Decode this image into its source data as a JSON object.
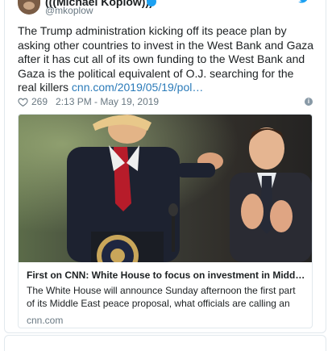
{
  "author": {
    "display_name": "(((Michael Koplow)))",
    "handle": "@mkoplow"
  },
  "tweet": {
    "text": "The Trump administration kicking off its peace plan by asking other countries to invest in the West Bank and Gaza after it has cut all of its own funding to the West Bank and Gaza is the political equivalent of O.J. searching for the real killers",
    "link": "cnn.com/2019/05/19/pol…"
  },
  "meta": {
    "likes": "269",
    "timestamp": "2:13 PM - May 19, 2019",
    "info_glyph": "i"
  },
  "link_card": {
    "title": "First on CNN: White House to focus on investment in Middle E…",
    "description": "The White House will announce Sunday afternoon the first part of its Middle East peace proposal, what officials are calling an economic",
    "domain": "cnn.com"
  },
  "icons": [
    "avatar",
    "verified-icon",
    "twitter-bird-icon",
    "heart-icon",
    "info-icon"
  ],
  "colors": {
    "link": "#2b7bb9",
    "verified": "#1da1f2",
    "muted": "#697882",
    "border": "#e1e8ed"
  }
}
